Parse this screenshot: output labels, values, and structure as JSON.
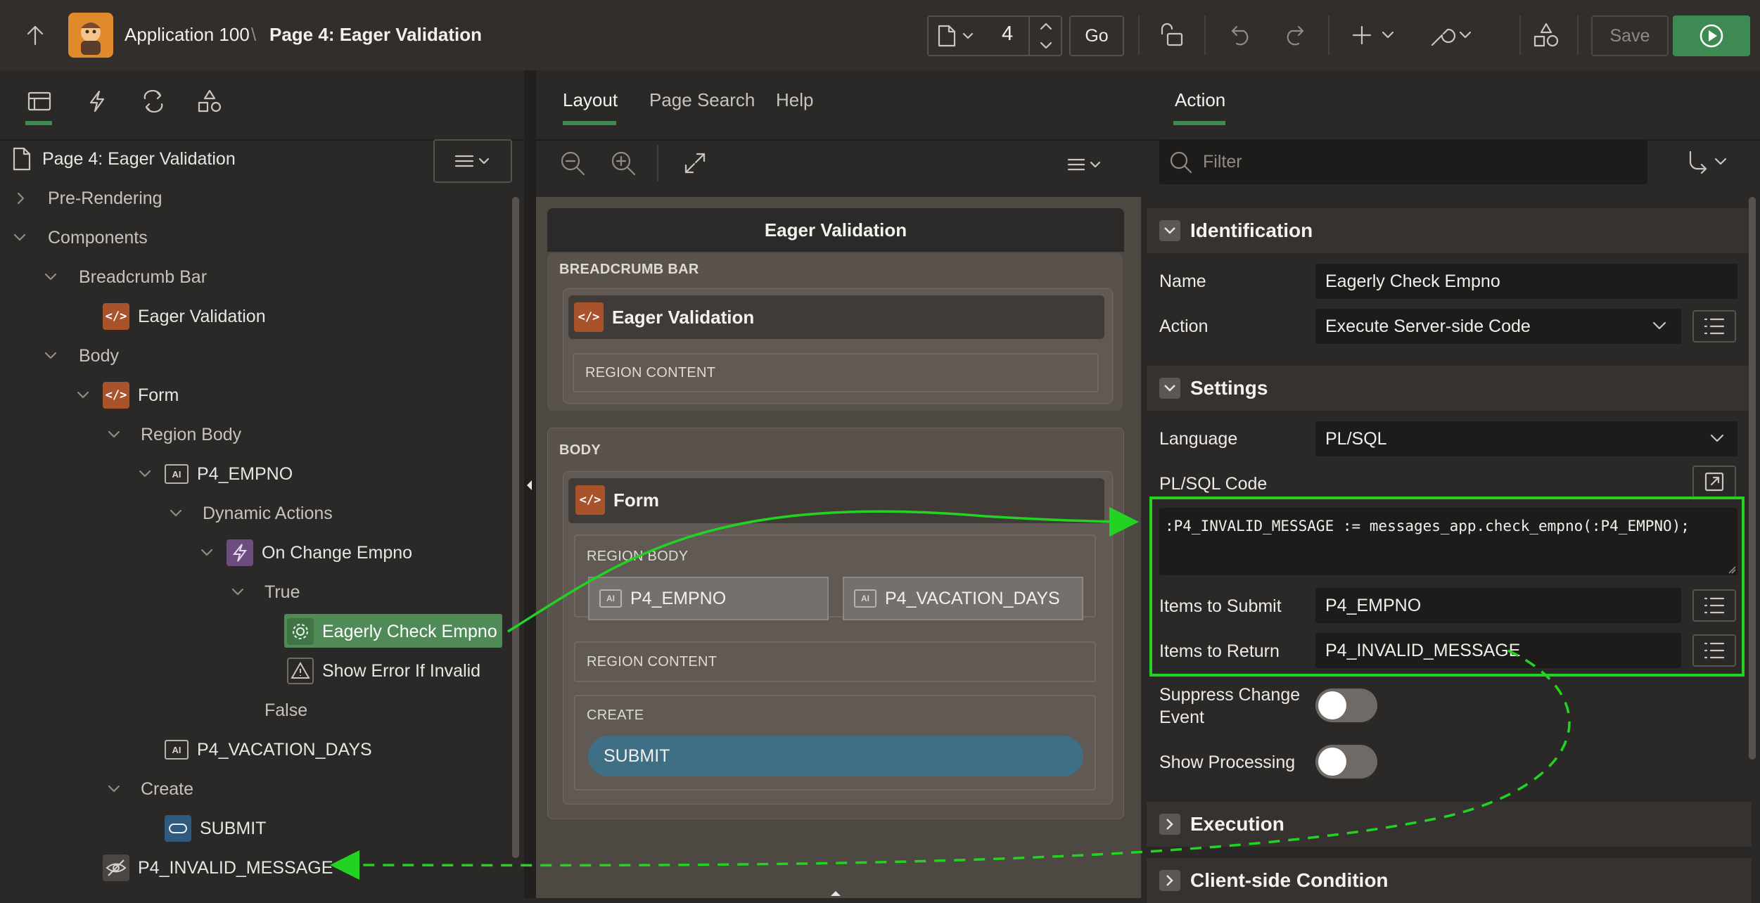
{
  "toolbar": {
    "app_name": "Application 100",
    "separator": "\\",
    "page_title": "Page 4: Eager Validation",
    "page_number": "4",
    "go_label": "Go",
    "save_label": "Save"
  },
  "left": {
    "page_node": "Page 4: Eager Validation",
    "tree": {
      "pre_rendering": "Pre-Rendering",
      "components": "Components",
      "breadcrumb_bar": "Breadcrumb Bar",
      "eager_validation": "Eager Validation",
      "body": "Body",
      "form": "Form",
      "region_body": "Region Body",
      "p4_empno": "P4_EMPNO",
      "dynamic_actions": "Dynamic Actions",
      "on_change_empno": "On Change Empno",
      "true_branch": "True",
      "eagerly_check": "Eagerly Check Empno",
      "show_error": "Show Error If Invalid",
      "false_branch": "False",
      "p4_vacation_days": "P4_VACATION_DAYS",
      "create": "Create",
      "submit": "SUBMIT",
      "p4_invalid_message": "P4_INVALID_MESSAGE"
    }
  },
  "middle": {
    "tabs": [
      "Layout",
      "Page Search",
      "Help"
    ],
    "page_header": "Eager Validation",
    "breadcrumb_bar_label": "BREADCRUMB BAR",
    "breadcrumb_region_title": "Eager Validation",
    "region_content_1": "REGION CONTENT",
    "body_label": "BODY",
    "form_title": "Form",
    "region_body_label": "REGION BODY",
    "item_empno": "P4_EMPNO",
    "item_vacation": "P4_VACATION_DAYS",
    "region_content_2": "REGION CONTENT",
    "create_label": "CREATE",
    "submit_button": "SUBMIT"
  },
  "right": {
    "tab": "Action",
    "filter_placeholder": "Filter",
    "identification": {
      "title": "Identification",
      "name_label": "Name",
      "name_value": "Eagerly Check Empno",
      "action_label": "Action",
      "action_value": "Execute Server-side Code"
    },
    "settings": {
      "title": "Settings",
      "language_label": "Language",
      "language_value": "PL/SQL",
      "code_label": "PL/SQL Code",
      "code_value": ":P4_INVALID_MESSAGE := messages_app.check_empno(:P4_EMPNO);",
      "submit_label": "Items to Submit",
      "submit_value": "P4_EMPNO",
      "return_label": "Items to Return",
      "return_value": "P4_INVALID_MESSAGE",
      "suppress_label_1": "Suppress Change",
      "suppress_label_2": "Event",
      "processing_label": "Show Processing"
    },
    "execution_title": "Execution",
    "client_condition_title": "Client-side Condition"
  },
  "colors": {
    "highlight_green": "#22d322",
    "selected_node": "#4f8a57",
    "submit_button": "#3f6f84",
    "run_button": "#3d8a53"
  }
}
